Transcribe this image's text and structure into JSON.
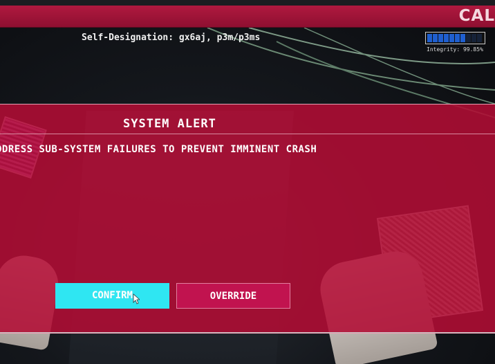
{
  "header": {
    "banner_text": "CAL"
  },
  "status": {
    "designation": "Self-Designation: gx6aj, p3m/p3ms",
    "integrity_label": "Integrity: 99.85%",
    "integrity_fraction": 0.9985,
    "integrity_color": "#1f5fd0"
  },
  "alert": {
    "title": "SYSTEM ALERT",
    "message": "DDRESS SUB-SYSTEM FAILURES TO PREVENT IMMINENT CRASH",
    "confirm_label": "CONFIRM",
    "override_label": "OVERRIDE",
    "background_color": "#b20c34",
    "confirm_color": "#2fe6f2",
    "override_color": "#c1134f"
  }
}
